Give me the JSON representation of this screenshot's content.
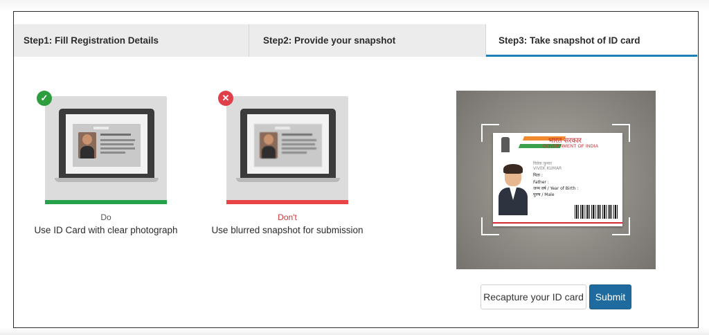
{
  "tabs": [
    {
      "label": "Step1: Fill Registration Details"
    },
    {
      "label": "Step2: Provide your snapshot"
    },
    {
      "label": "Step3: Take snapshot of ID card",
      "active": true
    }
  ],
  "examples": {
    "good": {
      "badge": "✓",
      "card_text": "Name: Jenny Joseph Lorem Ipsum is simply dummy text of the printing and typesetting industry.",
      "short": "Do",
      "long": "Use ID Card with clear photograph",
      "short_color": "#555555",
      "bar_color": "#24a14a"
    },
    "bad": {
      "badge": "✕",
      "short": "Don't",
      "long": "Use blurred snapshot for submission",
      "short_color": "#d0343a",
      "bar_color": "#e84446"
    }
  },
  "id_card": {
    "title_hi": "भारत सरकार",
    "title_en": "GOVERNMENT OF INDIA",
    "name_hi": "विवेक कुमार",
    "name_en": "VIVEK KUMAR",
    "father_hi": "पिता :",
    "father_en": "Father :",
    "yob": "जन्म वर्ष / Year of Birth :",
    "gender": "पुरुष / Male"
  },
  "buttons": {
    "recapture": "Recapture your ID card",
    "submit": "Submit"
  },
  "colors": {
    "accent": "#1f7fb4",
    "submit_bg": "#1f6a9e",
    "ok": "#2e9d3e",
    "error": "#e0404a"
  }
}
